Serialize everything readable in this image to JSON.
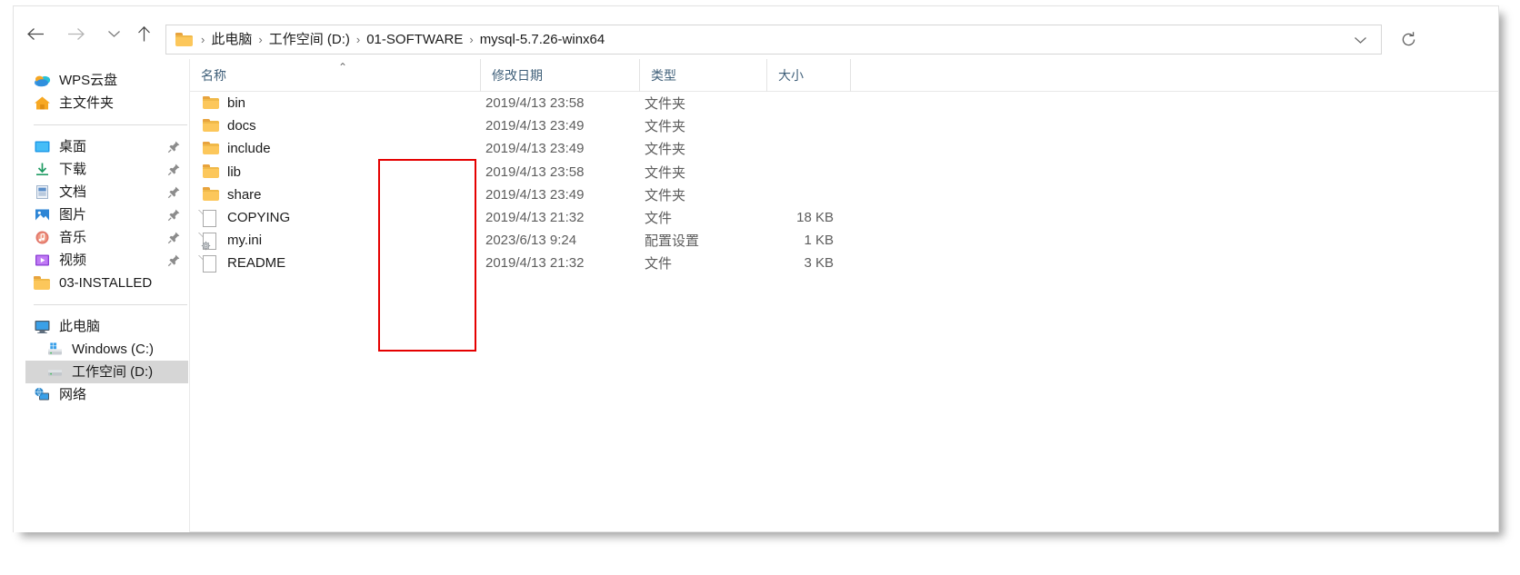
{
  "window": {
    "nav": {
      "back_label": "←",
      "forward_label": "→",
      "recent_label": "⌄",
      "up_label": "↑"
    },
    "address": {
      "folder_icon": "folder-icon",
      "separator": "›",
      "crumbs": [
        {
          "label": "此电脑"
        },
        {
          "label": "工作空间 (D:)"
        },
        {
          "label": "01-SOFTWARE"
        },
        {
          "label": "mysql-5.7.26-winx64"
        }
      ],
      "dropdown_icon": "chevron-down-icon"
    },
    "refresh_icon": "refresh-icon"
  },
  "sidebar": {
    "groups": [
      {
        "items": [
          {
            "label": "WPS云盘",
            "icon": "cloud-icon",
            "pinned": false,
            "indent": false,
            "selected": false
          },
          {
            "label": "主文件夹",
            "icon": "home-icon",
            "pinned": false,
            "indent": false,
            "selected": false
          }
        ]
      },
      {
        "items": [
          {
            "label": "桌面",
            "icon": "desktop-icon",
            "pinned": true,
            "indent": false,
            "selected": false
          },
          {
            "label": "下载",
            "icon": "download-icon",
            "pinned": true,
            "indent": false,
            "selected": false
          },
          {
            "label": "文档",
            "icon": "documents-icon",
            "pinned": true,
            "indent": false,
            "selected": false
          },
          {
            "label": "图片",
            "icon": "pictures-icon",
            "pinned": true,
            "indent": false,
            "selected": false
          },
          {
            "label": "音乐",
            "icon": "music-icon",
            "pinned": true,
            "indent": false,
            "selected": false
          },
          {
            "label": "视频",
            "icon": "videos-icon",
            "pinned": true,
            "indent": false,
            "selected": false
          },
          {
            "label": "03-INSTALLED",
            "icon": "folder-icon",
            "pinned": false,
            "indent": false,
            "selected": false
          }
        ]
      },
      {
        "items": [
          {
            "label": "此电脑",
            "icon": "this-pc-icon",
            "pinned": false,
            "indent": false,
            "selected": false
          },
          {
            "label": "Windows (C:)",
            "icon": "windows-drive-icon",
            "pinned": false,
            "indent": true,
            "selected": false
          },
          {
            "label": "工作空间 (D:)",
            "icon": "drive-icon",
            "pinned": false,
            "indent": true,
            "selected": true
          },
          {
            "label": "网络",
            "icon": "network-icon",
            "pinned": false,
            "indent": false,
            "selected": false
          }
        ]
      }
    ]
  },
  "filelist": {
    "columns": [
      {
        "label": "名称",
        "sorted": "asc"
      },
      {
        "label": "修改日期",
        "sorted": ""
      },
      {
        "label": "类型",
        "sorted": ""
      },
      {
        "label": "大小",
        "sorted": ""
      }
    ],
    "sort_caret": "⌃",
    "rows": [
      {
        "name": "bin",
        "date": "2019/4/13 23:58",
        "type": "文件夹",
        "size": "",
        "icon": "folder-icon"
      },
      {
        "name": "docs",
        "date": "2019/4/13 23:49",
        "type": "文件夹",
        "size": "",
        "icon": "folder-icon"
      },
      {
        "name": "include",
        "date": "2019/4/13 23:49",
        "type": "文件夹",
        "size": "",
        "icon": "folder-icon"
      },
      {
        "name": "lib",
        "date": "2019/4/13 23:58",
        "type": "文件夹",
        "size": "",
        "icon": "folder-icon"
      },
      {
        "name": "share",
        "date": "2019/4/13 23:49",
        "type": "文件夹",
        "size": "",
        "icon": "folder-icon"
      },
      {
        "name": "COPYING",
        "date": "2019/4/13 21:32",
        "type": "文件",
        "size": "18 KB",
        "icon": "file-icon"
      },
      {
        "name": "my.ini",
        "date": "2023/6/13 9:24",
        "type": "配置设置",
        "size": "1 KB",
        "icon": "config-file-icon"
      },
      {
        "name": "README",
        "date": "2019/4/13 21:32",
        "type": "文件",
        "size": "3 KB",
        "icon": "file-icon"
      }
    ]
  },
  "annotation": {
    "color": "#e50000",
    "shape": "rectangle"
  }
}
